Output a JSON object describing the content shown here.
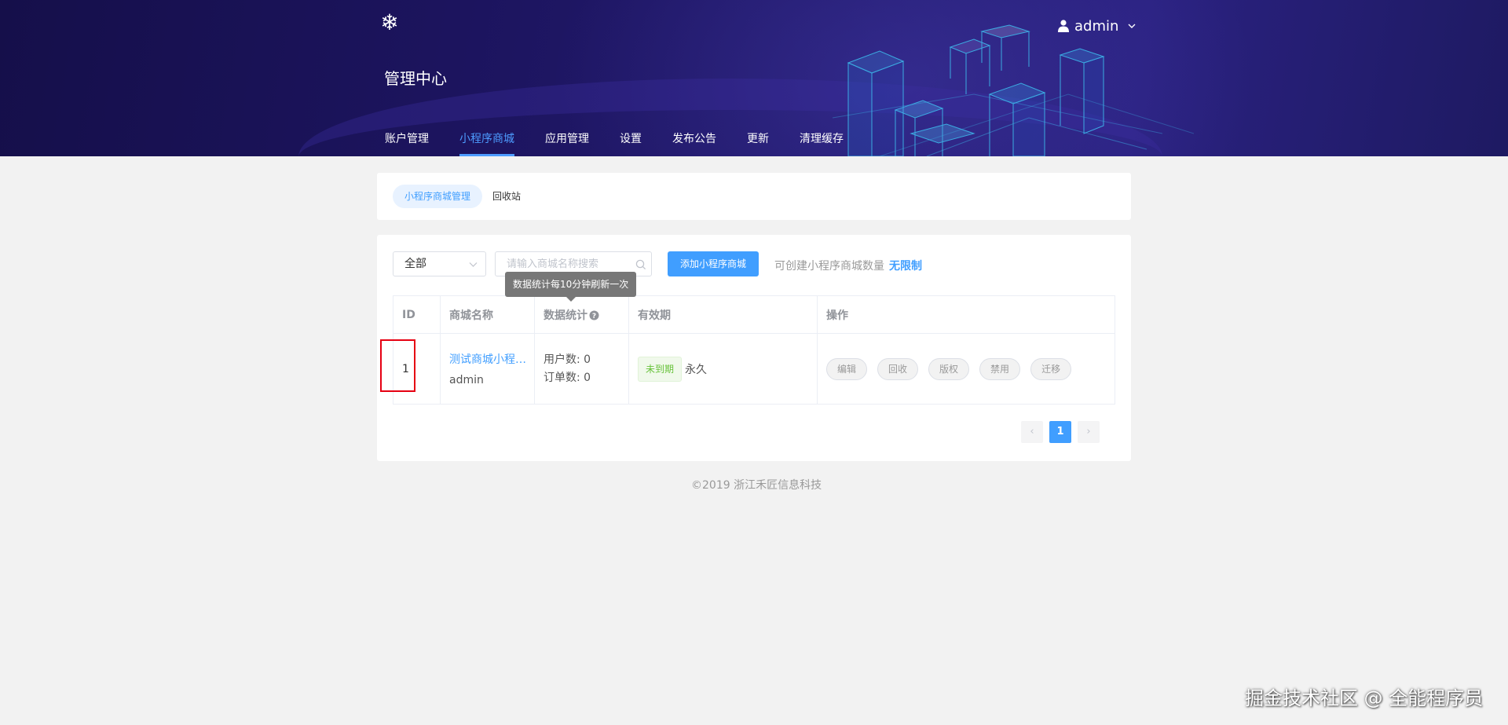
{
  "header": {
    "user_name": "admin",
    "title": "管理中心",
    "nav": [
      {
        "label": "账户管理",
        "active": false
      },
      {
        "label": "小程序商城",
        "active": true
      },
      {
        "label": "应用管理",
        "active": false
      },
      {
        "label": "设置",
        "active": false
      },
      {
        "label": "发布公告",
        "active": false
      },
      {
        "label": "更新",
        "active": false
      },
      {
        "label": "清理缓存",
        "active": false
      }
    ]
  },
  "tabs": {
    "manage": "小程序商城管理",
    "recycle": "回收站"
  },
  "toolbar": {
    "filter_value": "全部",
    "search_placeholder": "请输入商城名称搜索",
    "add_label": "添加小程序商城",
    "limit_label": "可创建小程序商城数量",
    "limit_value": "无限制",
    "tooltip": "数据统计每10分钟刷新一次"
  },
  "table": {
    "headers": {
      "id": "ID",
      "name": "商城名称",
      "stats": "数据统计",
      "validity": "有效期",
      "ops": "操作"
    },
    "rows": [
      {
        "id": "1",
        "name": "测试商城小程序...",
        "owner": "admin",
        "users": "用户数: 0",
        "orders": "订单数: 0",
        "status": "未到期",
        "validity": "永久",
        "actions": [
          "编辑",
          "回收",
          "版权",
          "禁用",
          "迁移"
        ]
      }
    ]
  },
  "pagination": {
    "current": "1",
    "prev_icon": "‹",
    "next_icon": "›"
  },
  "footer": "©2019 浙江禾匠信息科技",
  "watermark": "掘金技术社区 @ 全能程序员",
  "colors": {
    "accent": "#409eff",
    "header_bg": "#1c145e",
    "status_green": "#67c23a",
    "highlight_red": "#e60012"
  }
}
